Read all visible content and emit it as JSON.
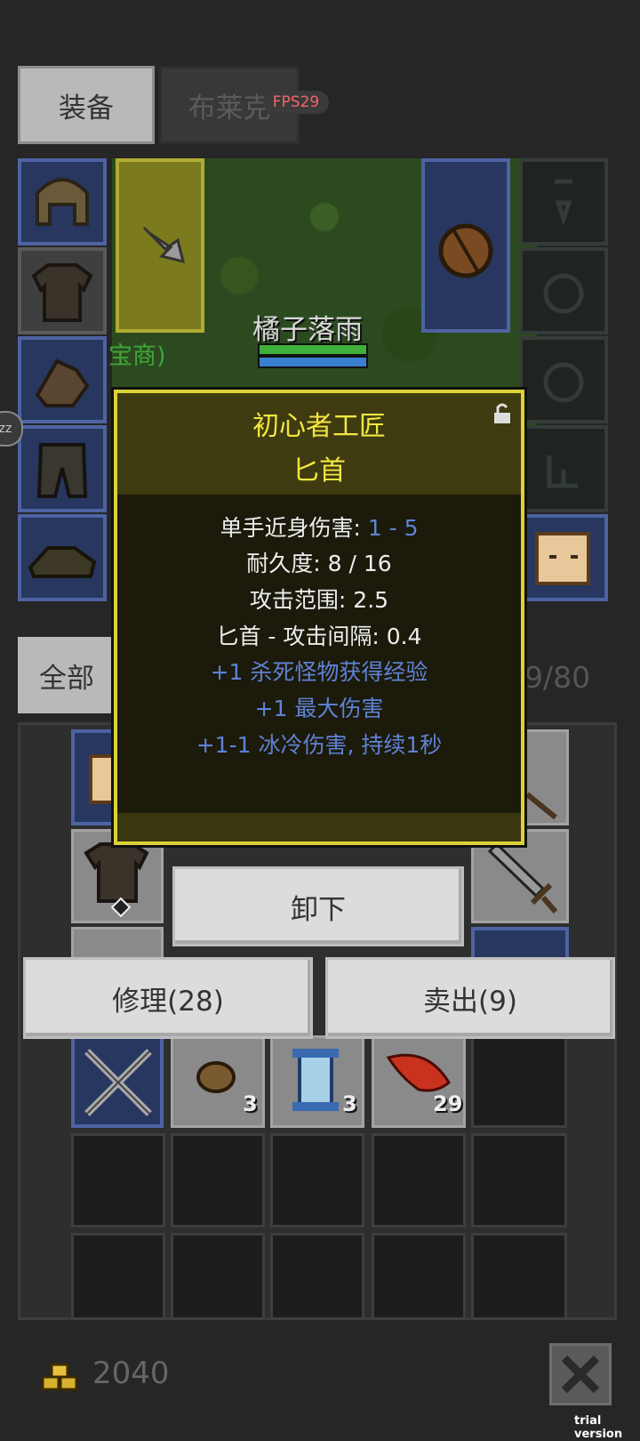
{
  "tabs": {
    "equipment": "装备",
    "character_name": "布莱克"
  },
  "fps": "FPS29",
  "player": {
    "name": "橘子落雨",
    "npc_label_partial": "宝商)"
  },
  "inventory_filter": {
    "all_label_partial": "全部",
    "capacity": "9/80"
  },
  "tooltip": {
    "title_line1": "初心者工匠",
    "title_line2": "匕首",
    "stats": [
      {
        "label": "单手近身伤害: ",
        "value": "1 - 5"
      },
      {
        "label": "耐久度: 8 / 16",
        "value": ""
      },
      {
        "label": "攻击范围: 2.5",
        "value": ""
      },
      {
        "label": "匕首 - 攻击间隔: 0.4",
        "value": ""
      }
    ],
    "bonuses": [
      "+1 杀死怪物获得经验",
      "+1 最大伤害",
      "+1-1 冰冷伤害, 持续1秒"
    ]
  },
  "actions": {
    "unequip": "卸下",
    "repair": "修理(28)",
    "sell": "卖出(9)"
  },
  "item_counts": {
    "stone": "3",
    "scroll": "3",
    "feather": "29"
  },
  "gold": "2040",
  "watermark": "trial version",
  "side_badge": "zz",
  "colors": {
    "tooltip_border": "#dcd237",
    "title": "#f2e641",
    "bonus_blue": "#5f82d4",
    "slot_blue": "#4d63a2"
  }
}
